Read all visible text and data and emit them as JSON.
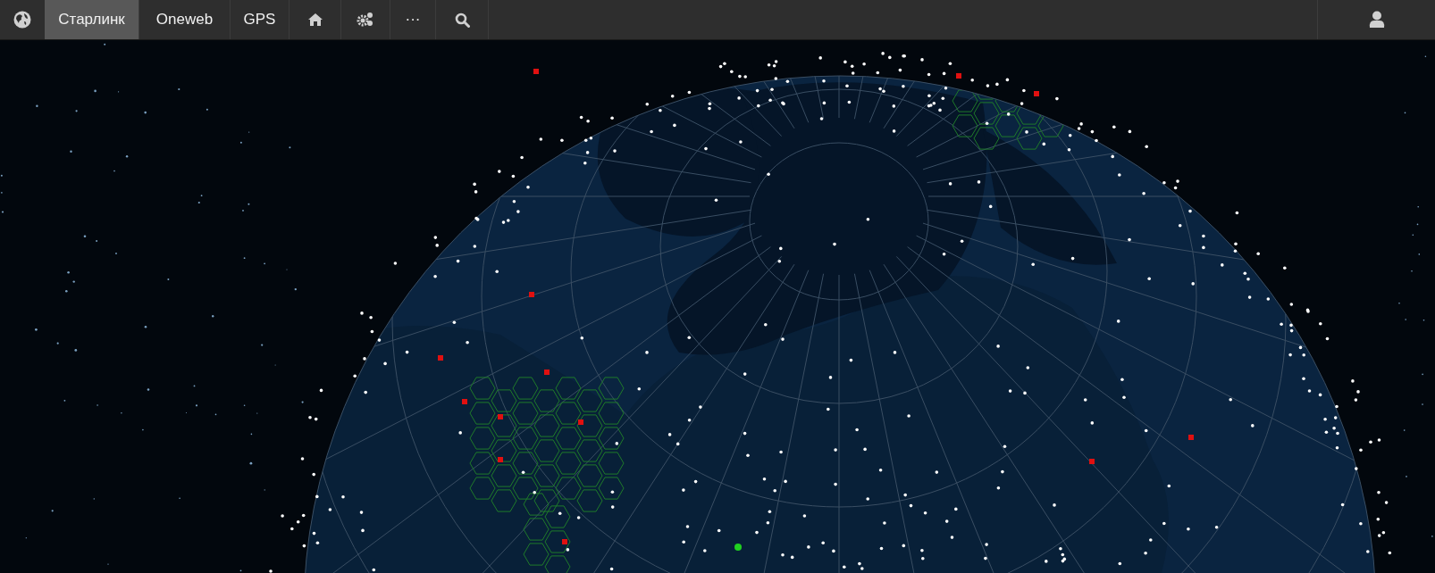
{
  "navbar": {
    "items": [
      {
        "kind": "text",
        "label": "Старлинк",
        "selected": true
      },
      {
        "kind": "text",
        "label": "Oneweb",
        "selected": false
      },
      {
        "kind": "text",
        "label": "GPS",
        "selected": false
      },
      {
        "kind": "home",
        "selected": false
      },
      {
        "kind": "settings",
        "selected": false
      },
      {
        "kind": "text",
        "label": "···",
        "selected": false
      },
      {
        "kind": "search",
        "selected": false
      }
    ]
  }
}
